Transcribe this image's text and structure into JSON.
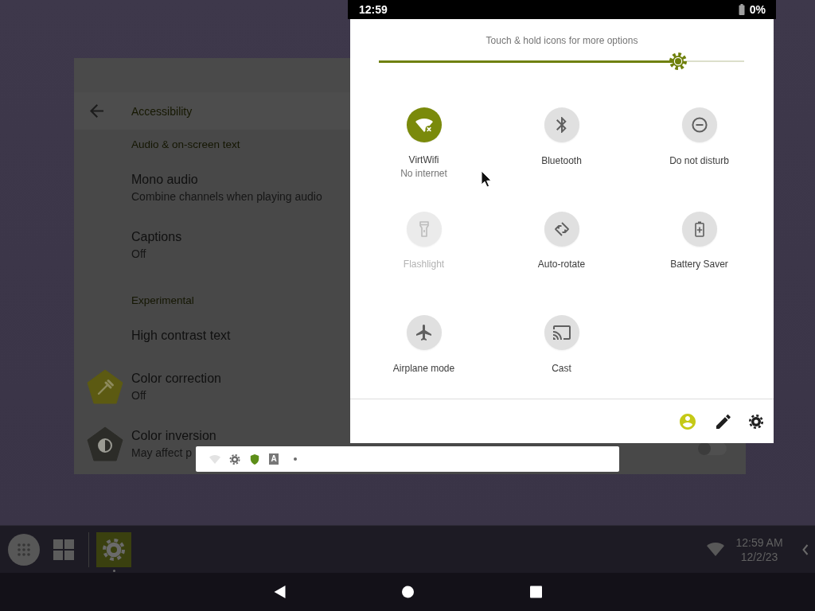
{
  "status_bar": {
    "time": "12:59",
    "battery": "0%"
  },
  "quick_settings": {
    "hint": "Touch & hold icons for more options",
    "brightness": {
      "level": 0.82
    },
    "tiles": [
      {
        "label": "VirtWifi",
        "status": "No internet",
        "on": true,
        "disabled": false
      },
      {
        "label": "Bluetooth",
        "on": false,
        "disabled": false
      },
      {
        "label": "Do not disturb",
        "on": false,
        "disabled": false
      },
      {
        "label": "Flashlight",
        "on": false,
        "disabled": true
      },
      {
        "label": "Auto-rotate",
        "on": false,
        "disabled": false
      },
      {
        "label": "Battery Saver",
        "on": false,
        "disabled": false
      },
      {
        "label": "Airplane mode",
        "on": false,
        "disabled": false
      },
      {
        "label": "Cast",
        "on": false,
        "disabled": false
      }
    ]
  },
  "settings_window": {
    "title": "Accessibility",
    "items": [
      {
        "kind": "header",
        "title": "Audio & on-screen text"
      },
      {
        "kind": "item",
        "title": "Mono audio",
        "summary": "Combine channels when playing audio"
      },
      {
        "kind": "item",
        "title": "Captions",
        "summary": "Off"
      },
      {
        "kind": "header",
        "title": "Experimental"
      },
      {
        "kind": "item",
        "title": "High contrast text"
      },
      {
        "kind": "item",
        "title": "Color correction",
        "summary": "Off",
        "color": "#5c5a12"
      },
      {
        "kind": "item",
        "title": "Color inversion",
        "summary": "May affect p",
        "color": "#2c2c28",
        "switch_on": false
      }
    ]
  },
  "notification_strip": {
    "input_badge": "A"
  },
  "taskbar": {
    "apps": [
      {
        "running": true
      }
    ],
    "time": "12:59 AM",
    "date": "12/2/23"
  }
}
